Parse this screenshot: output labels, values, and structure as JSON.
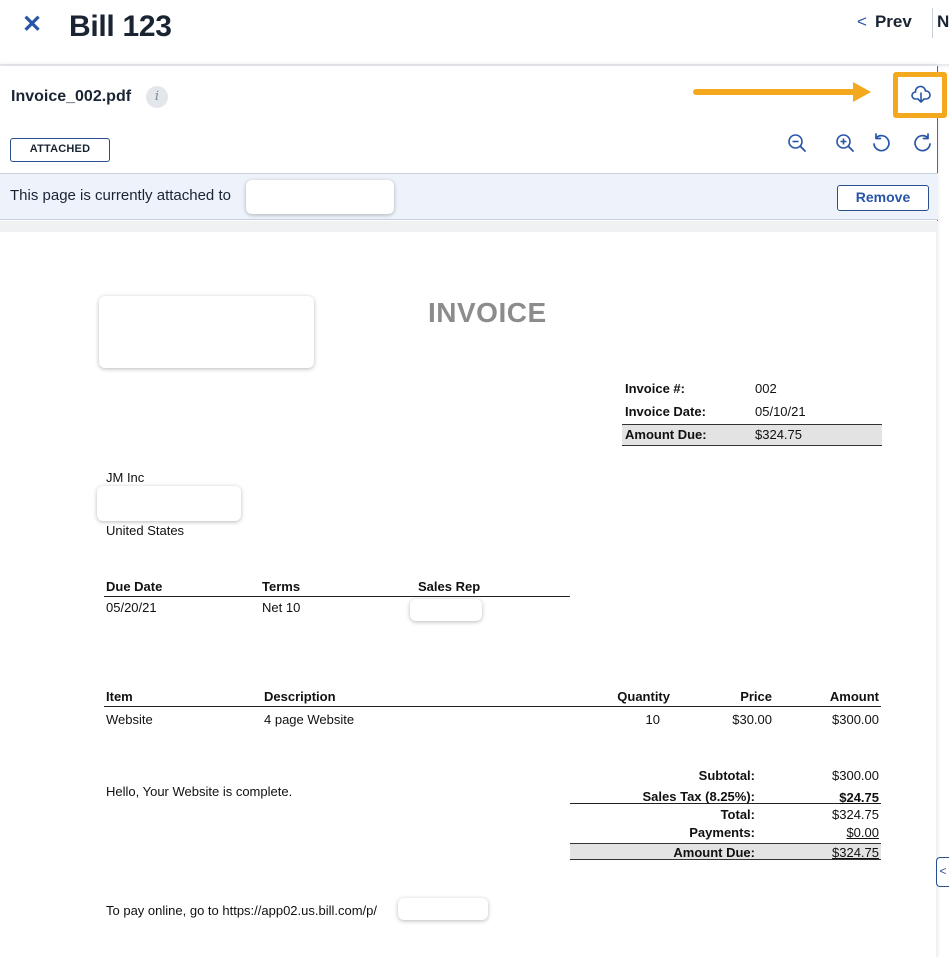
{
  "header": {
    "title": "Bill 123",
    "prev_label": "Prev",
    "next_label_partial": "N"
  },
  "document_panel": {
    "file_name": "Invoice_002.pdf",
    "status_badge": "ATTACHED",
    "attached_message": "This page is currently attached to",
    "remove_label": "Remove",
    "highlight_color": "#f3a81d"
  },
  "invoice": {
    "title": "INVOICE",
    "meta": [
      {
        "label": "Invoice #:",
        "value": "002"
      },
      {
        "label": "Invoice Date:",
        "value": "05/10/21"
      },
      {
        "label": "Amount Due:",
        "value": "$324.75"
      }
    ],
    "bill_to": {
      "company": "JM Inc",
      "country": "United States"
    },
    "terms_headers": [
      "Due Date",
      "Terms",
      "Sales Rep"
    ],
    "terms_values": [
      "05/20/21",
      "Net 10"
    ],
    "item_headers": [
      "Item",
      "Description",
      "Quantity",
      "Price",
      "Amount"
    ],
    "items": [
      {
        "item": "Website",
        "description": "4 page Website",
        "quantity": "10",
        "price": "$30.00",
        "amount": "$300.00"
      }
    ],
    "note": "Hello, Your Website is complete.",
    "totals": [
      {
        "label": "Subtotal:",
        "value": "$300.00"
      },
      {
        "label": "Sales Tax (8.25%):",
        "value": "$24.75"
      },
      {
        "label": "Total:",
        "value": "$324.75"
      },
      {
        "label": "Payments:",
        "value": "$0.00"
      },
      {
        "label": "Amount Due:",
        "value": "$324.75"
      }
    ],
    "pay_online": "To pay online, go to https://app02.us.bill.com/p/"
  }
}
